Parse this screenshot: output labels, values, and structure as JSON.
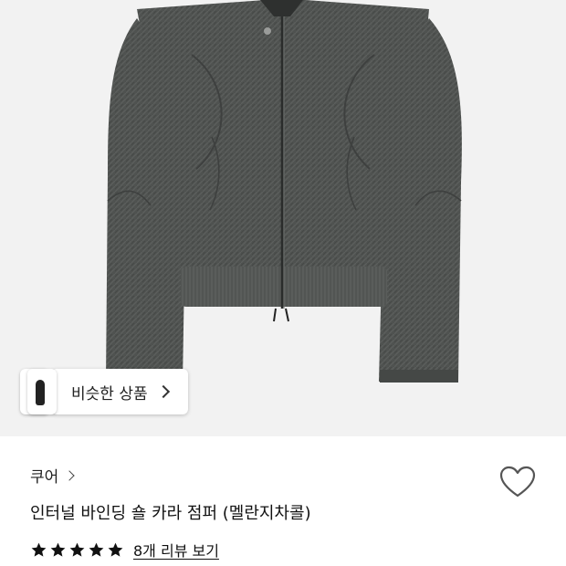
{
  "similar": {
    "label": "비슷한 상품"
  },
  "brand": {
    "name": "쿠어"
  },
  "product": {
    "title": "인터널 바인딩 숄 카라 점퍼 (멜란지차콜)"
  },
  "rating": {
    "stars": 5,
    "review_link": "8개 리뷰 보기"
  },
  "colors": {
    "jacket": "#4f5250",
    "background": "#f2f2f2",
    "text": "#111111"
  },
  "icons": {
    "like": "heart-outline-icon",
    "similar_arrow": "chevron-right-icon",
    "brand_arrow": "chevron-right-icon",
    "star": "star-filled-icon"
  }
}
